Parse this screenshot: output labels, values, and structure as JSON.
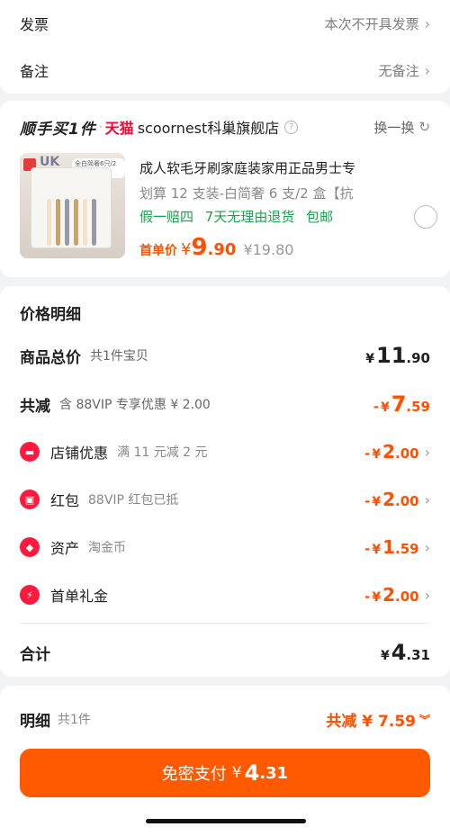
{
  "invoice": {
    "label": "发票",
    "value": "本次不开具发票"
  },
  "remark": {
    "label": "备注",
    "value": "无备注"
  },
  "shop": {
    "badge": "顺手买1件",
    "dot": "·",
    "platform": "天猫",
    "name": "scoornest科巢旗舰店",
    "switch_label": "换一换"
  },
  "product": {
    "title": "成人软毛牙刷家庭装家用正品男士专",
    "spec": "划算 12 支装-白简奢 6 支/2 盒【抗",
    "services": [
      "假一赔四",
      "7天无理由退货",
      "包邮"
    ],
    "first_label": "首单价",
    "price_yen": "¥",
    "price_int": "9",
    "price_dec": ".90",
    "original_price": "¥19.80",
    "image_text_uk": "UK",
    "image_tag": "全白简奢6只/2盒"
  },
  "price_detail": {
    "title": "价格明细",
    "goods_total": {
      "label": "商品总价",
      "sub": "共1件宝贝",
      "yen": "¥",
      "int": "11",
      "dec": ".90"
    },
    "total_discount": {
      "label": "共减",
      "sub": "含 88VIP 专享优惠 ¥ 2.00",
      "minus": "-",
      "yen": "¥",
      "int": "7",
      "dec": ".59"
    },
    "items": [
      {
        "label": "店铺优惠",
        "sub": "满 11 元减 2 元",
        "minus": "-",
        "yen": "¥",
        "int": "2",
        "dec": ".00"
      },
      {
        "label": "红包",
        "sub": "88VIP 红包已抵",
        "minus": "-",
        "yen": "¥",
        "int": "2",
        "dec": ".00"
      },
      {
        "label": "资产",
        "sub": "淘金币",
        "minus": "-",
        "yen": "¥",
        "int": "1",
        "dec": ".59"
      },
      {
        "label": "首单礼金",
        "sub": "",
        "minus": "-",
        "yen": "¥",
        "int": "2",
        "dec": ".00"
      }
    ],
    "total": {
      "label": "合计",
      "yen": "¥",
      "int": "4",
      "dec": ".31"
    }
  },
  "footer": {
    "detail_label": "明细",
    "detail_sub": "共1件",
    "discount_text": "共减 ¥ 7.59",
    "pay_label": "免密支付",
    "pay_yen": "¥",
    "pay_int": "4",
    "pay_dec": ".31"
  },
  "colors": {
    "accent": "#ff5000",
    "tmall": "#ff0036",
    "service_green": "#17a34a",
    "icon_red": "#ff1a3d"
  }
}
